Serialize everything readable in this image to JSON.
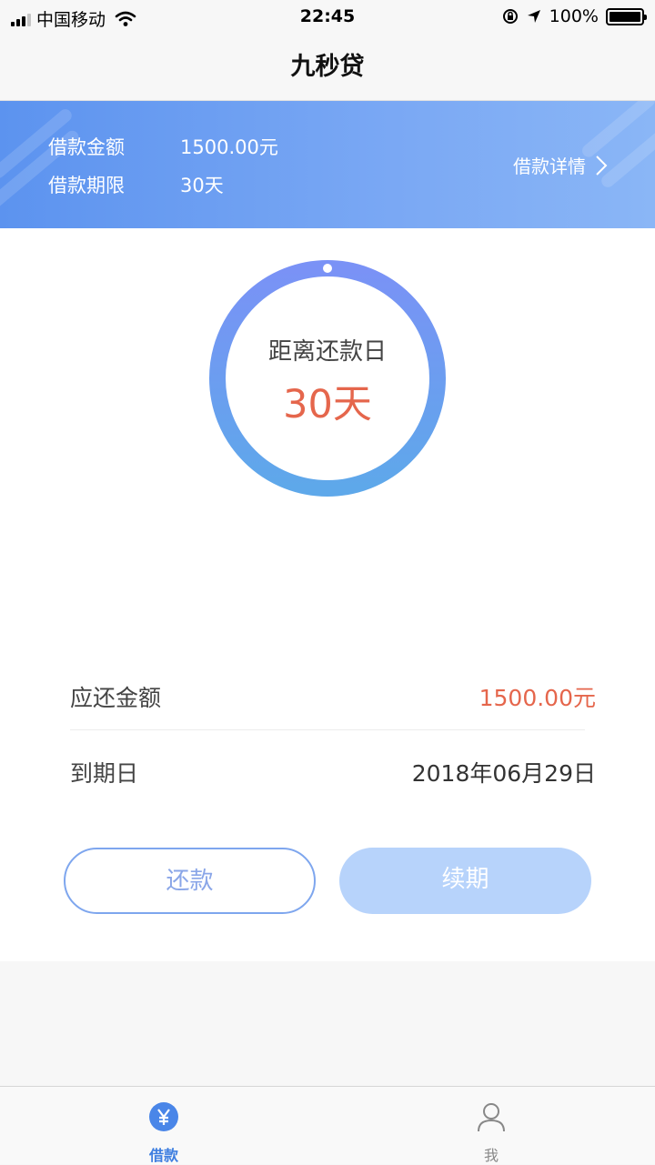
{
  "status_bar": {
    "carrier": "中国移动",
    "time": "22:45",
    "battery": "100%"
  },
  "nav": {
    "title": "九秒贷"
  },
  "banner": {
    "amount_label": "借款金额",
    "amount_value": "1500.00元",
    "term_label": "借款期限",
    "term_value": "30天",
    "detail_link": "借款详情"
  },
  "countdown": {
    "label": "距离还款日",
    "days": "30天"
  },
  "repayment": {
    "amount_label": "应还金额",
    "amount_value": "1500.00元",
    "due_label": "到期日",
    "due_value": "2018年06月29日"
  },
  "actions": {
    "repay": "还款",
    "renew": "续期"
  },
  "tabs": [
    {
      "label": "借款",
      "icon": "yen-circle-icon",
      "active": true
    },
    {
      "label": "我",
      "icon": "person-icon",
      "active": false
    }
  ],
  "colors": {
    "accent": "#5c93ef",
    "highlight": "#e5664c",
    "tab_active": "#3f7fe0"
  }
}
